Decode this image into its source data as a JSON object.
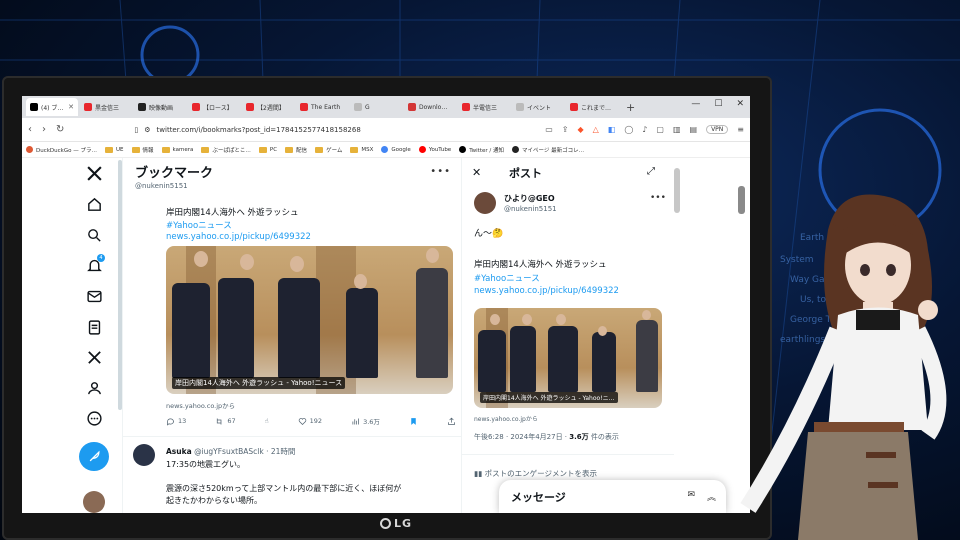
{
  "browser": {
    "tabs": [
      {
        "label": "(4) ブ…",
        "color": "#000000",
        "active": true
      },
      {
        "label": "黒金信三",
        "color": "#e8262c"
      },
      {
        "label": "映像動画",
        "color": "#222222"
      },
      {
        "label": "【ロース】",
        "color": "#e8262c"
      },
      {
        "label": "【2週間】",
        "color": "#e8262c"
      },
      {
        "label": "The Earth",
        "color": "#e8262c"
      },
      {
        "label": "G",
        "color": "#bbbbbb"
      },
      {
        "label": "Downlo…",
        "color": "#d33636"
      },
      {
        "label": "半電信三",
        "color": "#e8262c"
      },
      {
        "label": "イベント",
        "color": "#bbbbbb"
      },
      {
        "label": "これまで…",
        "color": "#e8262c"
      }
    ],
    "new_tab": "+",
    "window_controls": [
      "—",
      "☐",
      "✕"
    ],
    "url": "twitter.com/i/bookmarks?post_id=1784152577418158268",
    "vpn_label": "VPN",
    "bookmarks": [
      {
        "label": "DuckDuckGo — プラ…",
        "kind": "dot",
        "color": "#de5833"
      },
      {
        "label": "UE",
        "kind": "folder"
      },
      {
        "label": "情報",
        "kind": "folder"
      },
      {
        "label": "kamera",
        "kind": "folder"
      },
      {
        "label": "ぶーぱぱとこ…",
        "kind": "folder"
      },
      {
        "label": "PC",
        "kind": "folder"
      },
      {
        "label": "配信",
        "kind": "folder"
      },
      {
        "label": "ゲーム",
        "kind": "folder"
      },
      {
        "label": "MSX",
        "kind": "folder"
      },
      {
        "label": "Google",
        "kind": "dot",
        "color": "#4285f4"
      },
      {
        "label": "YouTube",
        "kind": "dot",
        "color": "#ff0000"
      },
      {
        "label": "Twitter / 通知",
        "kind": "dot",
        "color": "#000000"
      },
      {
        "label": "マイページ 最新ゴコレ…",
        "kind": "dot",
        "color": "#222222"
      }
    ]
  },
  "nav": {
    "notification_count": "4"
  },
  "timeline": {
    "title": "ブックマーク",
    "handle": "@nukenin5151",
    "more": "•••",
    "tweet1": {
      "text": "岸田内閣14人海外へ 外遊ラッシュ",
      "hashtag": "#Yahooニュース",
      "link": "news.yahoo.co.jp/pickup/6499322",
      "media_caption": "岸田内閣14人海外へ 外遊ラッシュ - Yahoo!ニュース",
      "source": "news.yahoo.co.jpから",
      "replies": "13",
      "retweets": "67",
      "likes": "192",
      "views": "3.6万"
    },
    "tweet2": {
      "name": "Asuka",
      "handle": "@iugYFsuxtBASclk",
      "time": "· 21時間",
      "line1": "17:35の地震エグい。",
      "line2": "震源の深さ520kmって上部マントル内の最下部に近く、ほぼ何が",
      "line3": "起きたかわからない場所。"
    }
  },
  "post_panel": {
    "title": "ポスト",
    "close": "✕",
    "expand": "⤢",
    "more": "•••",
    "name": "ひより@GEO",
    "handle": "@nukenin5151",
    "reply_text": "ん～🤔",
    "text": "岸田内閣14人海外へ 外遊ラッシュ",
    "hashtag": "#Yahooニュース",
    "link": "news.yahoo.co.jp/pickup/6499322",
    "media_caption": "岸田内閣14人海外へ 外遊ラッシュ - Yahoo!ニ…",
    "source": "news.yahoo.co.jpから",
    "timestamp": "午後6:28 · 2024年4月27日 · ",
    "views": "3.6万",
    "views_suffix": " 件の表示",
    "engagement": "ポストのエンゲージメントを表示"
  },
  "messages": {
    "title": "メッセージ"
  },
  "monitor": {
    "brand": "LG"
  },
  "colors": {
    "accent": "#1d9bf0",
    "text": "#0f1419",
    "muted": "#536471"
  }
}
